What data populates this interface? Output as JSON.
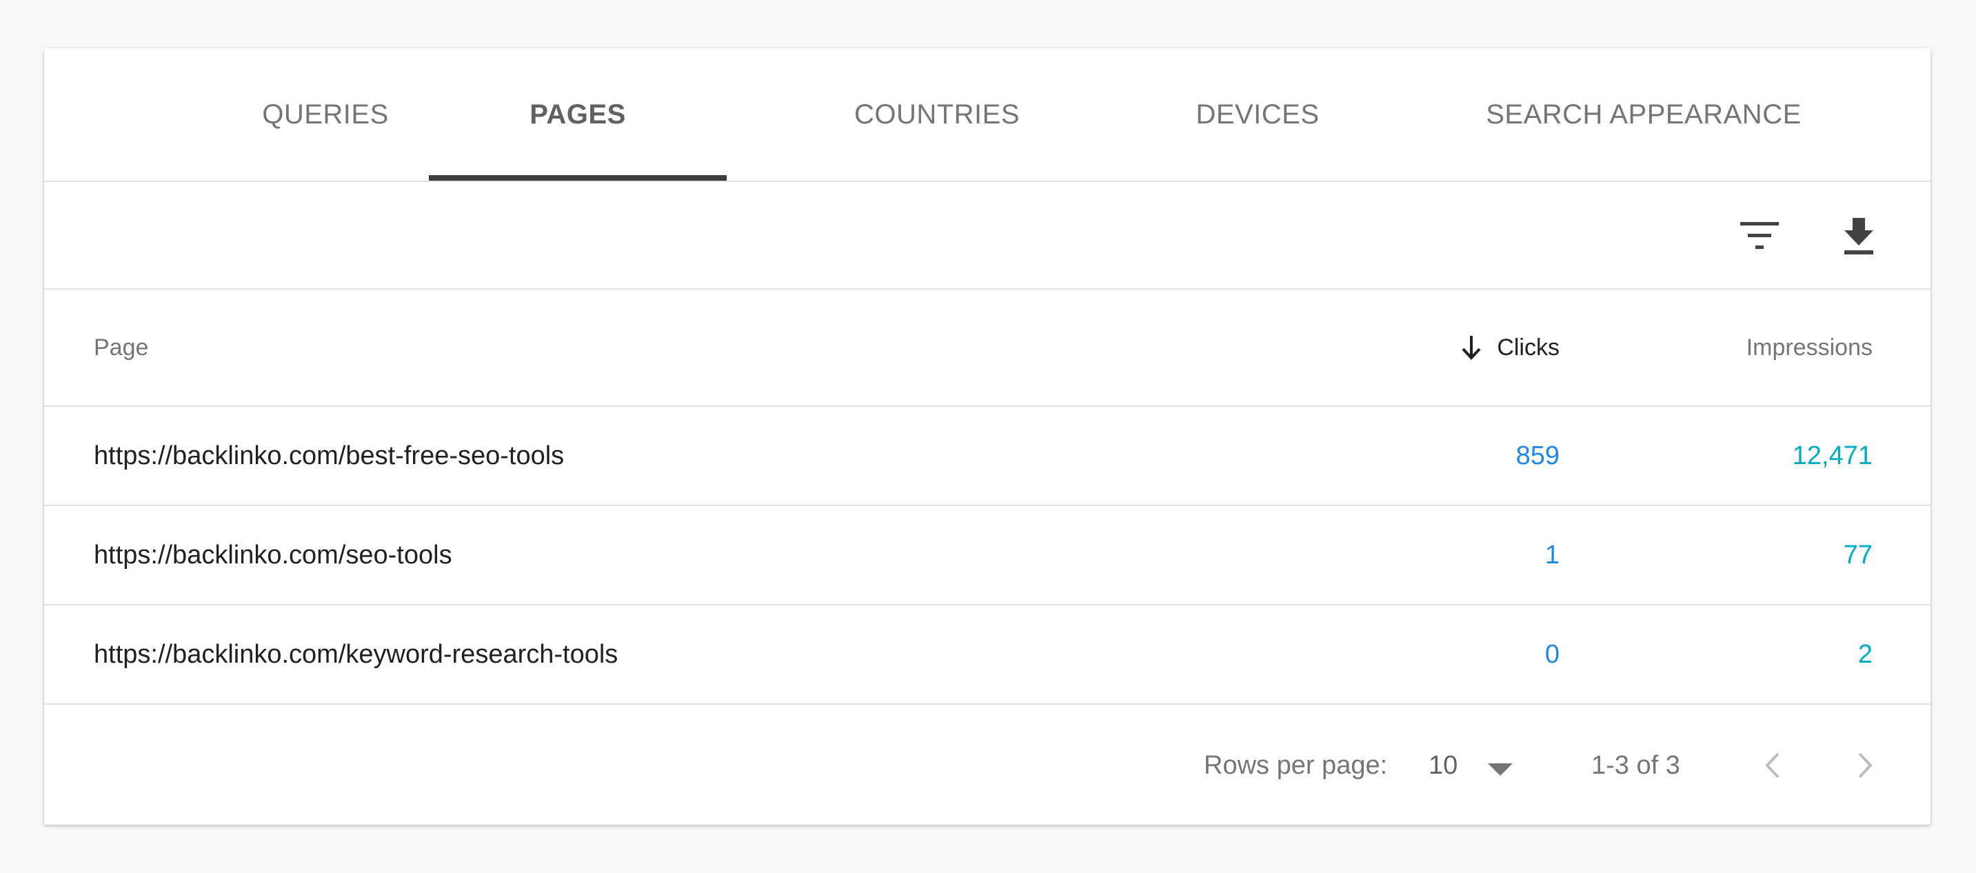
{
  "tabs": [
    {
      "label": "QUERIES",
      "active": false
    },
    {
      "label": "PAGES",
      "active": true
    },
    {
      "label": "COUNTRIES",
      "active": false
    },
    {
      "label": "DEVICES",
      "active": false
    },
    {
      "label": "SEARCH APPEARANCE",
      "active": false
    }
  ],
  "toolbar": {
    "filter_icon": "filter-list-icon",
    "download_icon": "download-icon"
  },
  "table": {
    "columns": {
      "page": "Page",
      "clicks": "Clicks",
      "impressions": "Impressions"
    },
    "sorted_column": "clicks",
    "sort_direction": "descending",
    "rows": [
      {
        "page": "https://backlinko.com/best-free-seo-tools",
        "clicks": "859",
        "impressions": "12,471"
      },
      {
        "page": "https://backlinko.com/seo-tools",
        "clicks": "1",
        "impressions": "77"
      },
      {
        "page": "https://backlinko.com/keyword-research-tools",
        "clicks": "0",
        "impressions": "2"
      }
    ]
  },
  "pagination": {
    "rows_per_page_label": "Rows per page:",
    "rows_per_page_value": "10",
    "range_text": "1-3 of 3"
  },
  "colors": {
    "clicks": "#1e88e5",
    "impressions": "#00acc1",
    "tab_indicator": "#3c3c3c"
  }
}
